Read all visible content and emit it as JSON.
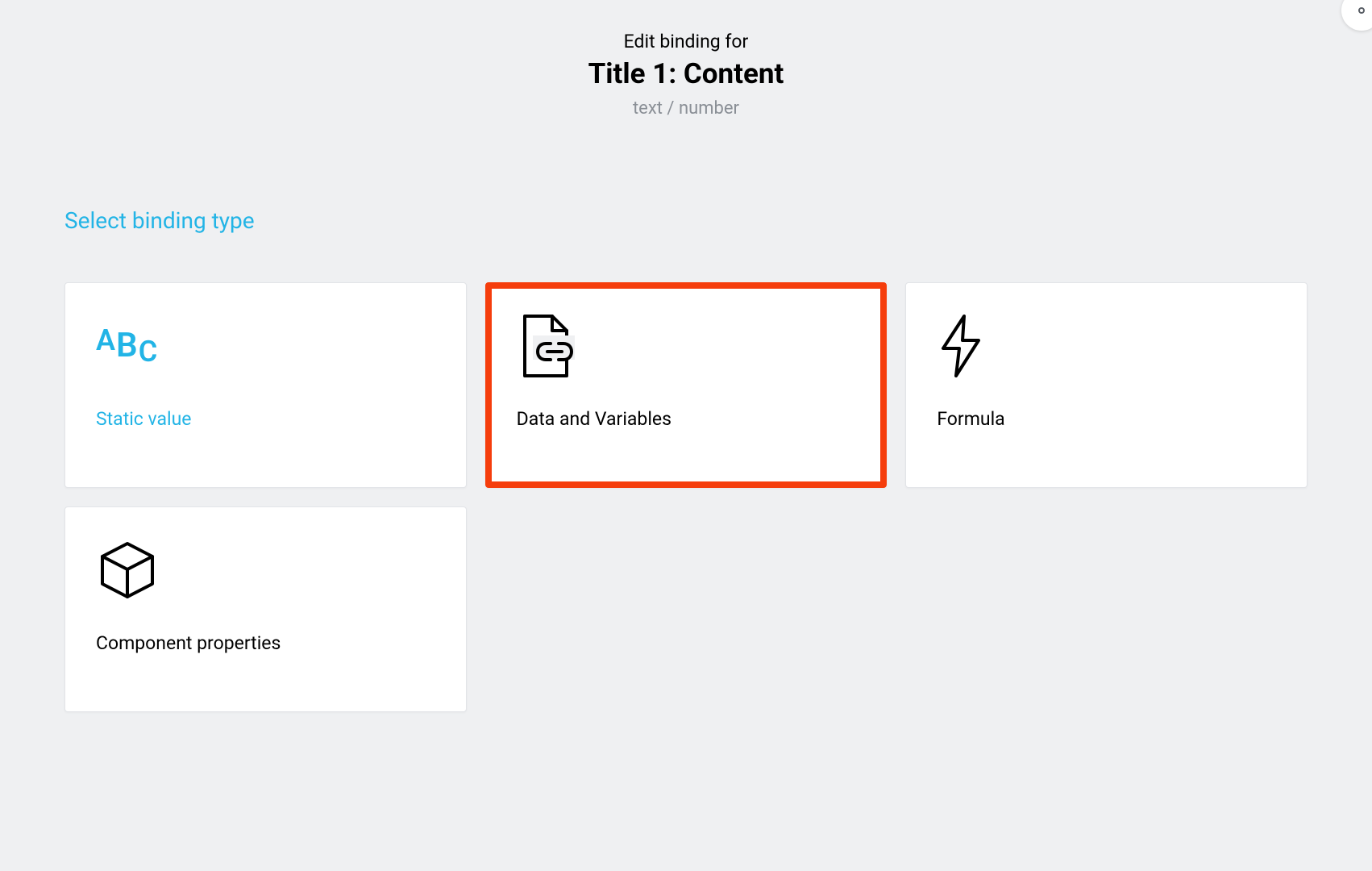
{
  "header": {
    "prefix": "Edit binding for",
    "title": "Title 1: Content",
    "subtitle": "text / number"
  },
  "section_label": "Select binding type",
  "cards": [
    {
      "label": "Static value",
      "icon": "abc-icon",
      "selected": true,
      "highlighted": false
    },
    {
      "label": "Data and Variables",
      "icon": "file-link-icon",
      "selected": false,
      "highlighted": true
    },
    {
      "label": "Formula",
      "icon": "lightning-icon",
      "selected": false,
      "highlighted": false
    },
    {
      "label": "Component properties",
      "icon": "cube-icon",
      "selected": false,
      "highlighted": false
    }
  ]
}
